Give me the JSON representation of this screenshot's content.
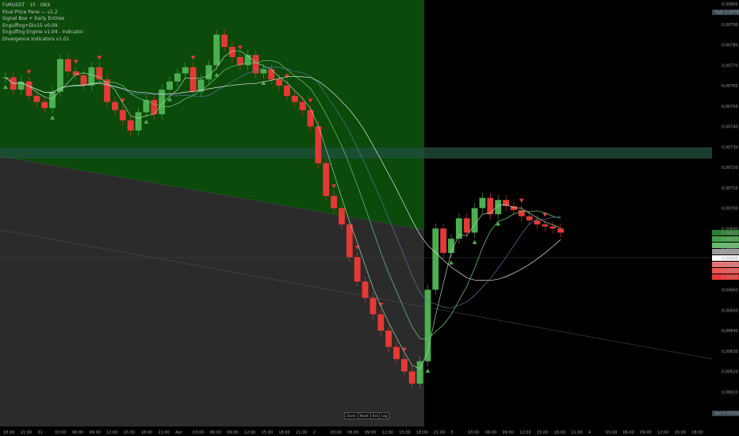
{
  "legend": {
    "symbol": "FURUSDT · 15 · OKX",
    "indicators": [
      "Final Price Pane — v1.2",
      "Signal Box + Early Entries",
      "Engulfing+Div15 v0.09",
      "Engulfing Engine v1.04 - Indicator",
      "Divergence Indicators v1.01"
    ]
  },
  "price_axis": {
    "ticks": [
      "0,00800",
      "0,00790",
      "0,00780",
      "0,00770",
      "0,00760",
      "0,00750",
      "0,00740",
      "0,00730",
      "0,00720",
      "0,00710",
      "0,00700",
      "0,00690",
      "0,00680",
      "0,00670",
      "0,00660",
      "0,00650",
      "0,00640",
      "0,00630",
      "0,00620",
      "0,00610",
      "0,00600"
    ],
    "tick_values": [
      0.008,
      0.0079,
      0.0078,
      0.0077,
      0.0076,
      0.0075,
      0.0074,
      0.0073,
      0.0072,
      0.0071,
      0.007,
      0.0069,
      0.0068,
      0.0067,
      0.0066,
      0.0065,
      0.0064,
      0.0063,
      0.0062,
      0.0061,
      0.006
    ],
    "top_label": "0,00800",
    "high_tag": "High",
    "high_value": "0,00785",
    "low_tag": "Sell",
    "low_value": "0,00335",
    "current_tags": [
      {
        "text": "0,00620",
        "color": "#2e7d32"
      },
      {
        "text": "0,00615",
        "color": "#43a047"
      },
      {
        "text": "0,00610",
        "color": "#66bb6a"
      },
      {
        "text": "0,00605",
        "color": "#9e9e9e"
      },
      {
        "text": "0,00600",
        "color": "#ffffff"
      },
      {
        "text": "0,00595",
        "color": "#e57373"
      },
      {
        "text": "0,00590",
        "color": "#ef5350"
      },
      {
        "text": "0,00585",
        "color": "#e53935"
      }
    ]
  },
  "time_axis": {
    "ticks": [
      "18:00",
      "21:00",
      "31",
      "03:00",
      "06:00",
      "09:00",
      "12:00",
      "15:00",
      "18:00",
      "21:00",
      "Apr",
      "03:00",
      "06:00",
      "09:00",
      "12:00",
      "15:00",
      "18:00",
      "21:00",
      "2",
      "03:00",
      "06:00",
      "09:00",
      "12:00",
      "15:00",
      "18:00",
      "21:00",
      "3",
      "03:00",
      "06:00",
      "09:00",
      "12:00",
      "15:00",
      "18:00",
      "21:00",
      "4",
      "03:00",
      "06:00",
      "09:00",
      "12:00",
      "15:00",
      "18:00"
    ]
  },
  "controls": [
    "Zoom",
    "Reset",
    "Ext",
    "Log"
  ],
  "colors": {
    "bull": "#4caf50",
    "bear": "#e53935",
    "ma_fast": "#a5d6a7",
    "ma_slow": "#66bb6a",
    "vwap": "#4a7aa0",
    "band": "#e0e0e0",
    "green_zone": "#0b4a0b",
    "grey_zone": "#2b2b2b"
  },
  "chart_data": {
    "type": "candlestick",
    "symbol": "FURUSDT",
    "interval": "15",
    "exchange": "OKX",
    "price_range": [
      0.006,
      0.008
    ],
    "close_path": [
      [
        0,
        0.00764
      ],
      [
        1,
        0.00758
      ],
      [
        2,
        0.00762
      ],
      [
        3,
        0.00755
      ],
      [
        4,
        0.00752
      ],
      [
        5,
        0.00749
      ],
      [
        6,
        0.00757
      ],
      [
        7,
        0.00773
      ],
      [
        8,
        0.00767
      ],
      [
        9,
        0.00765
      ],
      [
        10,
        0.0076
      ],
      [
        11,
        0.00769
      ],
      [
        12,
        0.00763
      ],
      [
        13,
        0.00752
      ],
      [
        14,
        0.00748
      ],
      [
        15,
        0.00743
      ],
      [
        16,
        0.00738
      ],
      [
        17,
        0.00747
      ],
      [
        18,
        0.00753
      ],
      [
        19,
        0.00746
      ],
      [
        20,
        0.00758
      ],
      [
        21,
        0.00762
      ],
      [
        22,
        0.00766
      ],
      [
        23,
        0.00769
      ],
      [
        24,
        0.00757
      ],
      [
        25,
        0.00763
      ],
      [
        26,
        0.0077
      ],
      [
        27,
        0.00785
      ],
      [
        28,
        0.00779
      ],
      [
        29,
        0.00774
      ],
      [
        30,
        0.0077
      ],
      [
        31,
        0.00775
      ],
      [
        32,
        0.00766
      ],
      [
        33,
        0.00768
      ],
      [
        34,
        0.00763
      ],
      [
        35,
        0.0076
      ],
      [
        36,
        0.00755
      ],
      [
        37,
        0.00752
      ],
      [
        38,
        0.00748
      ],
      [
        39,
        0.0074
      ],
      [
        40,
        0.00722
      ],
      [
        41,
        0.00706
      ],
      [
        42,
        0.007
      ],
      [
        43,
        0.00692
      ],
      [
        44,
        0.00676
      ],
      [
        45,
        0.00664
      ],
      [
        46,
        0.00656
      ],
      [
        47,
        0.00648
      ],
      [
        48,
        0.0064
      ],
      [
        49,
        0.00632
      ],
      [
        50,
        0.00626
      ],
      [
        51,
        0.0062
      ],
      [
        52,
        0.00614
      ],
      [
        53,
        0.00625
      ],
      [
        54,
        0.0066
      ],
      [
        55,
        0.0069
      ],
      [
        56,
        0.00678
      ],
      [
        57,
        0.00685
      ],
      [
        58,
        0.00695
      ],
      [
        59,
        0.00688
      ],
      [
        60,
        0.007
      ],
      [
        61,
        0.00705
      ],
      [
        62,
        0.00697
      ],
      [
        63,
        0.00704
      ],
      [
        64,
        0.00701
      ],
      [
        65,
        0.00699
      ],
      [
        66,
        0.00696
      ],
      [
        67,
        0.00694
      ],
      [
        68,
        0.00692
      ],
      [
        69,
        0.00691
      ],
      [
        70,
        0.0069
      ],
      [
        71,
        0.00688
      ]
    ],
    "signals_buy": 60,
    "signals_sell": 55
  }
}
